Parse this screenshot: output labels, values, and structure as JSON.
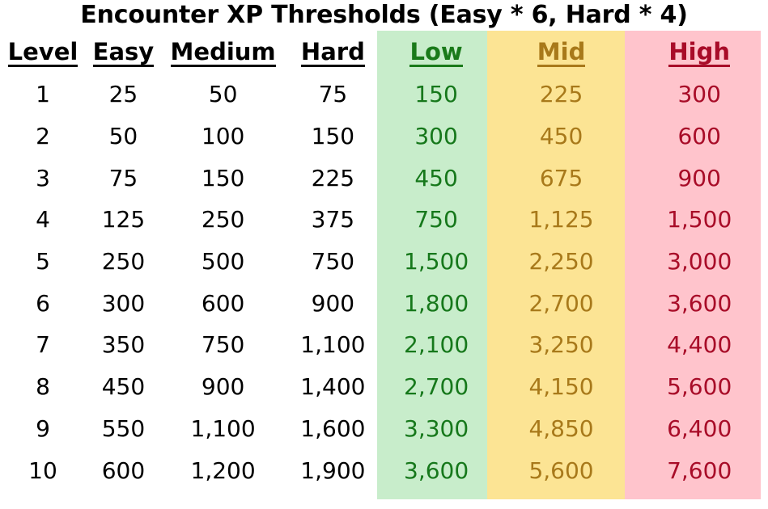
{
  "title": "Encounter XP Thresholds (Easy * 6, Hard * 4)",
  "columns": [
    {
      "key": "level",
      "label": "Level",
      "color": "#000000",
      "band": null
    },
    {
      "key": "easy",
      "label": "Easy",
      "color": "#000000",
      "band": null
    },
    {
      "key": "medium",
      "label": "Medium",
      "color": "#000000",
      "band": null
    },
    {
      "key": "hard",
      "label": "Hard",
      "color": "#000000",
      "band": null
    },
    {
      "key": "low",
      "label": "Low",
      "color": "#1a7a1a",
      "band": "#C8EDCB"
    },
    {
      "key": "mid",
      "label": "Mid",
      "color": "#A8791A",
      "band": "#FCE494"
    },
    {
      "key": "high",
      "label": "High",
      "color": "#A80C28",
      "band": "#FFC4CC"
    }
  ],
  "rows": [
    {
      "level": "1",
      "easy": "25",
      "medium": "50",
      "hard": "75",
      "low": "150",
      "mid": "225",
      "high": "300"
    },
    {
      "level": "2",
      "easy": "50",
      "medium": "100",
      "hard": "150",
      "low": "300",
      "mid": "450",
      "high": "600"
    },
    {
      "level": "3",
      "easy": "75",
      "medium": "150",
      "hard": "225",
      "low": "450",
      "mid": "675",
      "high": "900"
    },
    {
      "level": "4",
      "easy": "125",
      "medium": "250",
      "hard": "375",
      "low": "750",
      "mid": "1,125",
      "high": "1,500"
    },
    {
      "level": "5",
      "easy": "250",
      "medium": "500",
      "hard": "750",
      "low": "1,500",
      "mid": "2,250",
      "high": "3,000"
    },
    {
      "level": "6",
      "easy": "300",
      "medium": "600",
      "hard": "900",
      "low": "1,800",
      "mid": "2,700",
      "high": "3,600"
    },
    {
      "level": "7",
      "easy": "350",
      "medium": "750",
      "hard": "1,100",
      "low": "2,100",
      "mid": "3,250",
      "high": "4,400"
    },
    {
      "level": "8",
      "easy": "450",
      "medium": "900",
      "hard": "1,400",
      "low": "2,700",
      "mid": "4,150",
      "high": "5,600"
    },
    {
      "level": "9",
      "easy": "550",
      "medium": "1,100",
      "hard": "1,600",
      "low": "3,300",
      "mid": "4,850",
      "high": "6,400"
    },
    {
      "level": "10",
      "easy": "600",
      "medium": "1,200",
      "hard": "1,900",
      "low": "3,600",
      "mid": "5,600",
      "high": "7,600"
    }
  ]
}
